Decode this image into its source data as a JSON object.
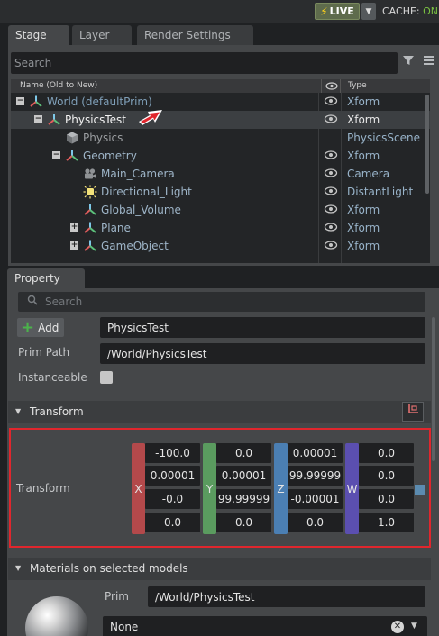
{
  "topbar": {
    "live_label": "LIVE",
    "cache_label": "CACHE: ",
    "cache_state": "ON"
  },
  "stage_tabs": [
    "Stage",
    "Layer",
    "Render Settings"
  ],
  "stage": {
    "search_placeholder": "Search",
    "col_name": "Name (Old to New)",
    "col_type": "Type",
    "rows": [
      {
        "name": "World (defaultPrim)",
        "type": "Xform",
        "icon": "xform-icon",
        "expander": "−"
      },
      {
        "name": "PhysicsTest",
        "type": "Xform",
        "icon": "xform-icon",
        "expander": "−"
      },
      {
        "name": "Physics",
        "type": "PhysicsScene",
        "icon": "cube-icon",
        "expander": ""
      },
      {
        "name": "Geometry",
        "type": "Xform",
        "icon": "xform-icon",
        "expander": "−"
      },
      {
        "name": "Main_Camera",
        "type": "Camera",
        "icon": "camera-icon",
        "expander": ""
      },
      {
        "name": "Directional_Light",
        "type": "DistantLight",
        "icon": "light-icon",
        "expander": ""
      },
      {
        "name": "Global_Volume",
        "type": "Xform",
        "icon": "xform-icon",
        "expander": ""
      },
      {
        "name": "Plane",
        "type": "Xform",
        "icon": "xform-icon",
        "expander": "+"
      },
      {
        "name": "GameObject",
        "type": "Xform",
        "icon": "xform-icon",
        "expander": "+"
      }
    ]
  },
  "property": {
    "tab_label": "Property",
    "search_placeholder": "Search",
    "add_label": "Add",
    "name_value": "PhysicsTest",
    "prim_path_label": "Prim Path",
    "prim_path_value": "/World/PhysicsTest",
    "instanceable_label": "Instanceable",
    "transform_section": "Transform",
    "transform_label": "Transform",
    "axes": [
      "X",
      "Y",
      "Z",
      "W"
    ],
    "axis_colors": [
      "#b3494b",
      "#5a9b5f",
      "#4b7fb3",
      "#5b4fb0"
    ],
    "matrix": [
      [
        "-100.0",
        "0.00001",
        "-0.0",
        "0.0"
      ],
      [
        "0.0",
        "0.00001",
        "99.99999",
        "0.0"
      ],
      [
        "0.00001",
        "99.99999",
        "-0.00001",
        "0.0"
      ],
      [
        "0.0",
        "0.0",
        "0.0",
        "1.0"
      ]
    ],
    "materials_section": "Materials on selected models",
    "prim_label": "Prim",
    "material_prim_value": "/World/PhysicsTest",
    "material_value": "None"
  }
}
